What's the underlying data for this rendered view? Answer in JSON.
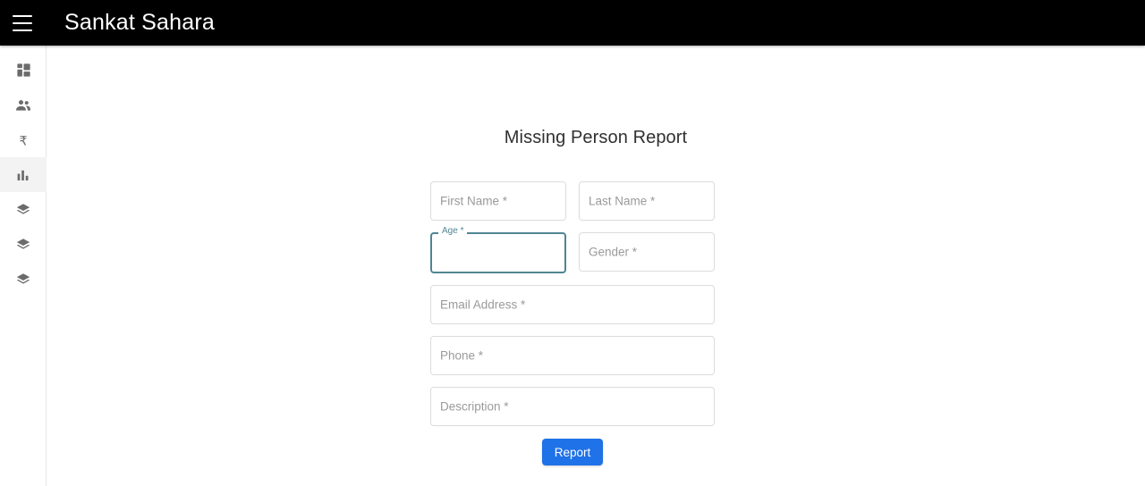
{
  "header": {
    "title": "Sankat Sahara",
    "menu_icon": "hamburger-menu-icon"
  },
  "sidebar": {
    "items": [
      {
        "name": "dashboard",
        "icon": "dashboard-grid-icon",
        "active": false
      },
      {
        "name": "people",
        "icon": "people-group-icon",
        "active": false
      },
      {
        "name": "funds",
        "icon": "rupee-icon",
        "active": false
      },
      {
        "name": "reports",
        "icon": "bar-chart-icon",
        "active": true
      },
      {
        "name": "layers-one",
        "icon": "layers-icon",
        "active": false
      },
      {
        "name": "layers-two",
        "icon": "layers-icon",
        "active": false
      },
      {
        "name": "layers-three",
        "icon": "layers-icon",
        "active": false
      }
    ]
  },
  "form": {
    "title": "Missing Person Report",
    "fields": {
      "first_name": {
        "label": "First Name *",
        "value": ""
      },
      "last_name": {
        "label": "Last Name *",
        "value": ""
      },
      "age": {
        "label": "Age *",
        "value": "",
        "focused": true
      },
      "gender": {
        "label": "Gender *",
        "value": ""
      },
      "email": {
        "label": "Email Address *",
        "value": ""
      },
      "phone": {
        "label": "Phone *",
        "value": ""
      },
      "description": {
        "label": "Description *",
        "value": ""
      }
    },
    "submit_label": "Report"
  },
  "colors": {
    "topbar_bg": "#000000",
    "accent_button": "#1f72e8",
    "focus_border": "#4f8593",
    "field_border": "#dcdcdc",
    "sidebar_active_bg": "#f3f3f3",
    "placeholder_text": "#9a9a9a"
  }
}
